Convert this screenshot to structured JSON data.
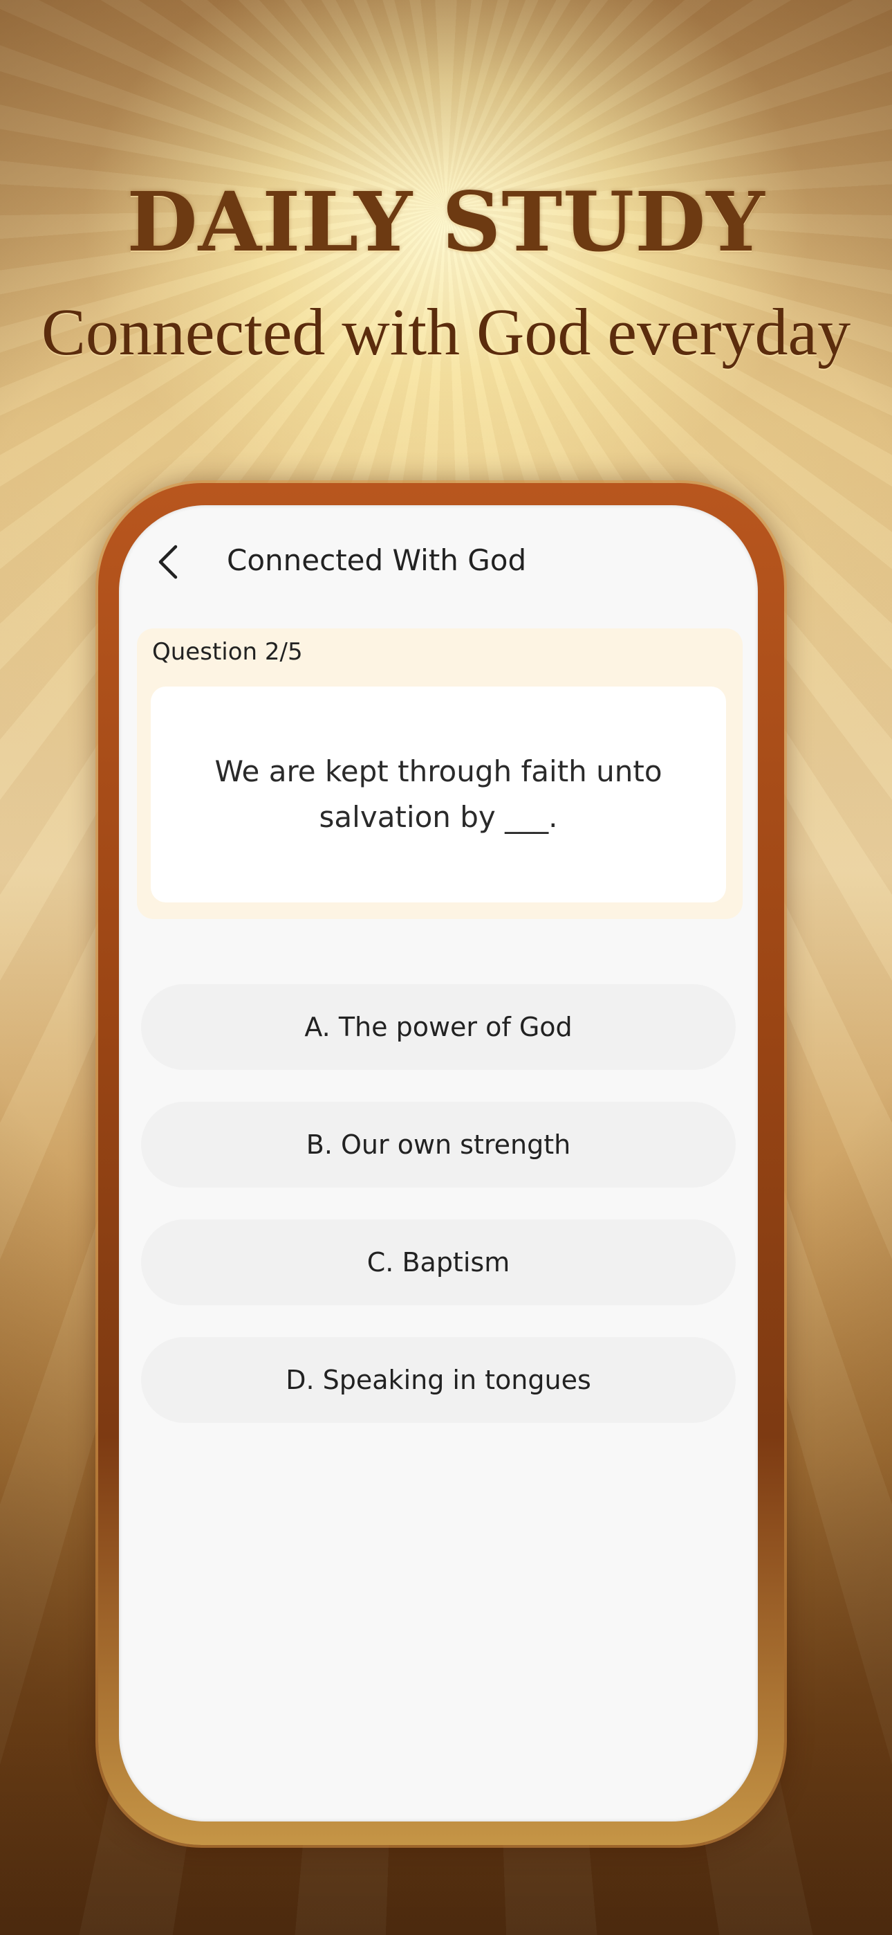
{
  "banner": {
    "title": "DAILY STUDY",
    "subtitle": "Connected with God everyday"
  },
  "app": {
    "back_icon": "chevron-left-icon",
    "title": "Connected With God"
  },
  "quiz": {
    "progress_label": "Question 2/5",
    "question": "We are kept through faith unto salvation by ___.",
    "options": [
      {
        "label": "A. The power of God"
      },
      {
        "label": "B. Our own strength"
      },
      {
        "label": "C. Baptism"
      },
      {
        "label": "D. Speaking in tongues"
      }
    ]
  },
  "colors": {
    "frame": "#9a4514",
    "banner_text": "#6d3a12",
    "question_card_bg": "#fdf4e3",
    "option_bg": "#f1f1f1"
  }
}
